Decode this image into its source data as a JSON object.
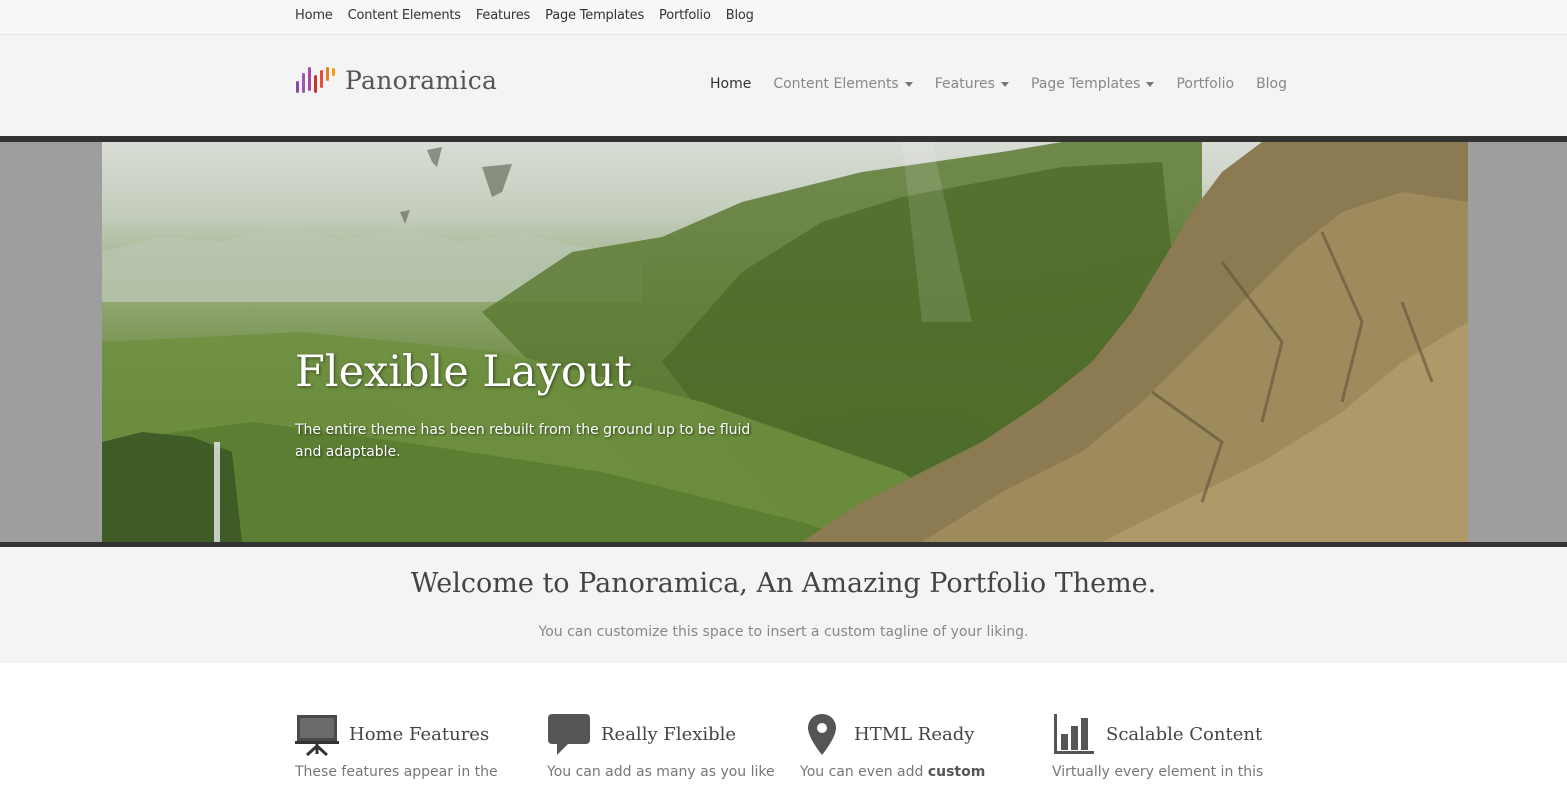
{
  "topbar": {
    "items": [
      "Home",
      "Content Elements",
      "Features",
      "Page Templates",
      "Portfolio",
      "Blog"
    ]
  },
  "header": {
    "logo_text": "Panoramica",
    "nav": [
      {
        "label": "Home",
        "active": true,
        "dropdown": false
      },
      {
        "label": "Content Elements",
        "active": false,
        "dropdown": true
      },
      {
        "label": "Features",
        "active": false,
        "dropdown": true
      },
      {
        "label": "Page Templates",
        "active": false,
        "dropdown": true
      },
      {
        "label": "Portfolio",
        "active": false,
        "dropdown": false
      },
      {
        "label": "Blog",
        "active": false,
        "dropdown": false
      }
    ]
  },
  "hero": {
    "title": "Flexible Layout",
    "text": "The entire theme has been rebuilt from the ground up to be fluid and adaptable."
  },
  "welcome": {
    "title": "Welcome to Panoramica, An Amazing Portfolio Theme.",
    "tagline": "You can customize this space to insert a custom tagline of your liking."
  },
  "features": [
    {
      "title": "Home Features",
      "icon": "presentation-board-icon",
      "desc": "These features appear in the",
      "desc_bold": ""
    },
    {
      "title": "Really Flexible",
      "icon": "speech-bubble-icon",
      "desc": "You can add as many as you like",
      "desc_bold": ""
    },
    {
      "title": "HTML Ready",
      "icon": "map-pin-icon",
      "desc": "You can even add ",
      "desc_bold": "custom"
    },
    {
      "title": "Scalable Content",
      "icon": "bar-chart-icon",
      "desc": "Virtually every element in this",
      "desc_bold": ""
    }
  ],
  "colors": {
    "hero_border": "#333333",
    "hero_band": "#9e9e9e",
    "header_bg": "#f4f4f4",
    "logo_bars": [
      "#8e44ad",
      "#9b59b6",
      "#c0392b",
      "#e74c3c",
      "#e67e22"
    ]
  }
}
